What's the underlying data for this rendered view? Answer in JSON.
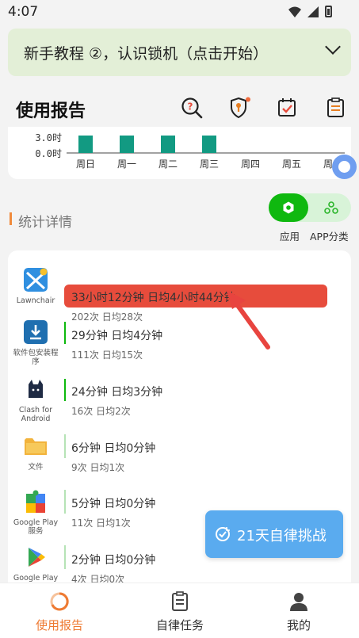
{
  "status_bar": {
    "time": "4:07"
  },
  "tutorial": {
    "text": "新手教程 ②，认识锁机（点击开始）"
  },
  "header": {
    "title": "使用报告"
  },
  "chart_data": {
    "type": "bar",
    "categories": [
      "周日",
      "周一",
      "周二",
      "周三",
      "周四",
      "周五",
      "周六"
    ],
    "values": [
      3.3,
      3.3,
      3.3,
      3.3,
      0,
      0,
      0
    ],
    "ytick_labels": [
      "3.0时",
      "0.0时"
    ],
    "color": "#129a82"
  },
  "section": {
    "title": "统计详情"
  },
  "view_toggle": {
    "app_label": "应用",
    "category_label": "APP分类",
    "active_color": "#0fb80f"
  },
  "apps": [
    {
      "name": "Lawnchair",
      "usage": "33小时12分钟  日均4小时44分钟",
      "count": "202次  日均28次"
    },
    {
      "name": "软件包安装程序",
      "usage": "29分钟  日均4分钟",
      "count": "111次  日均15次"
    },
    {
      "name": "Clash for Android",
      "usage": "24分钟  日均3分钟",
      "count": "16次  日均2次"
    },
    {
      "name": "文件",
      "usage": "6分钟  日均0分钟",
      "count": "9次  日均1次"
    },
    {
      "name": "Google Play 服务",
      "usage": "5分钟  日均0分钟",
      "count": "11次  日均1次"
    },
    {
      "name": "Google Play",
      "usage": "2分钟  日均0分钟",
      "count": "4次  日均0次"
    }
  ],
  "challenge_button": {
    "label": "21天自律挑战"
  },
  "bottom_nav": [
    {
      "label": "使用报告",
      "active": true
    },
    {
      "label": "自律任务",
      "active": false
    },
    {
      "label": "我的",
      "active": false
    }
  ]
}
